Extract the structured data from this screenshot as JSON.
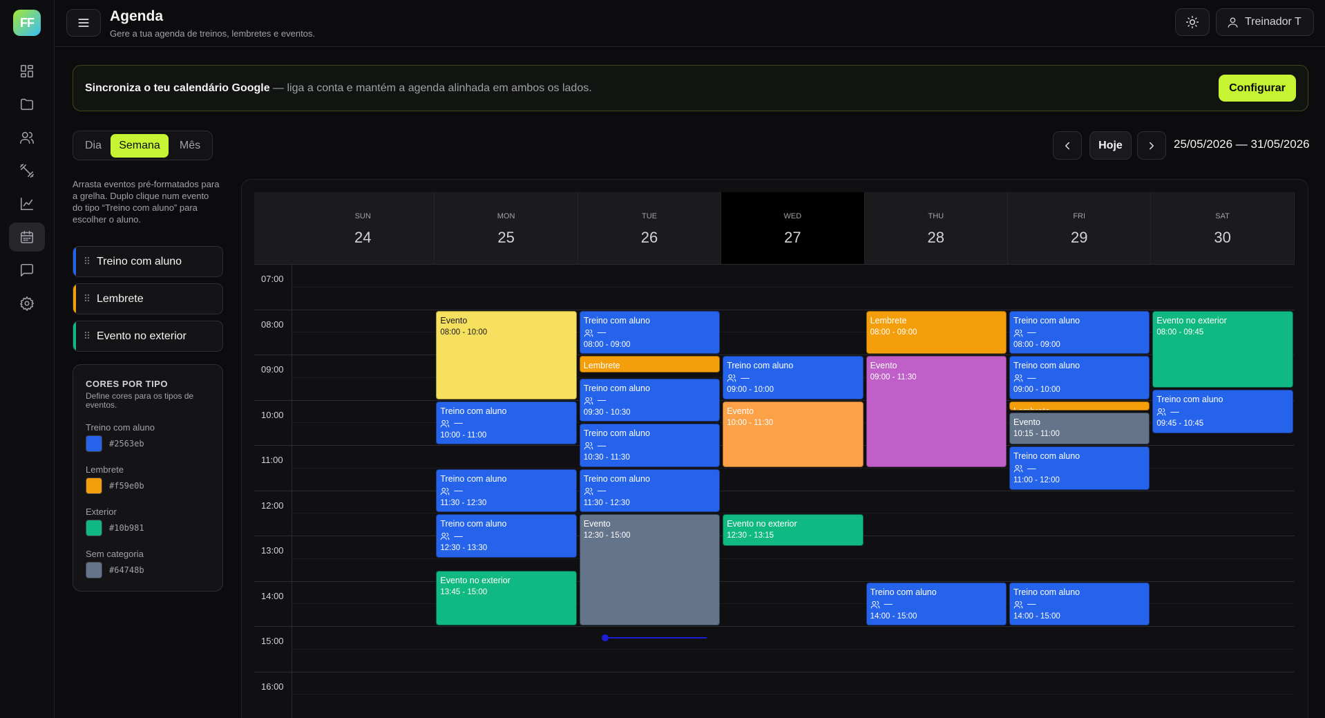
{
  "app": {
    "logo_text": "FF"
  },
  "header": {
    "title": "Agenda",
    "subtitle": "Gere a tua agenda de treinos, lembretes e eventos.",
    "user_label": "Treinador T"
  },
  "sidebar": {
    "items": [
      {
        "icon": "dashboard-icon"
      },
      {
        "icon": "folder-icon"
      },
      {
        "icon": "users-icon"
      },
      {
        "icon": "dumbbell-icon"
      },
      {
        "icon": "chart-icon"
      },
      {
        "icon": "calendar-icon",
        "active": true
      },
      {
        "icon": "message-icon"
      },
      {
        "icon": "gear-icon"
      }
    ]
  },
  "banner": {
    "strong": "Sincroniza o teu calendário Google",
    "text": " — liga a conta e mantém a agenda alinhada em ambos os lados.",
    "button": "Configurar"
  },
  "views": {
    "day": "Dia",
    "week": "Semana",
    "month": "Mês",
    "active": "week"
  },
  "nav": {
    "today": "Hoje",
    "range": "25/05/2026 — 31/05/2026"
  },
  "panel": {
    "hint": "Arrasta eventos pré-formatados para a grelha. Duplo clique num evento do tipo “Treino com aluno” para escolher o aluno.",
    "drag_items": [
      {
        "label": "Treino com aluno",
        "color": "#2563eb"
      },
      {
        "label": "Lembrete",
        "color": "#f59e0b"
      },
      {
        "label": "Evento no exterior",
        "color": "#10b981"
      }
    ],
    "colors": {
      "title": "CORES POR TIPO",
      "subtitle": "Define cores para os tipos de eventos.",
      "types": [
        {
          "label": "Treino com aluno",
          "hex": "#2563eb"
        },
        {
          "label": "Lembrete",
          "hex": "#f59e0b"
        },
        {
          "label": "Exterior",
          "hex": "#10b981"
        },
        {
          "label": "Sem categoria",
          "hex": "#64748b"
        }
      ]
    }
  },
  "calendar": {
    "days": [
      {
        "dow": "SUN",
        "num": "24"
      },
      {
        "dow": "MON",
        "num": "25"
      },
      {
        "dow": "TUE",
        "num": "26"
      },
      {
        "dow": "WED",
        "num": "27",
        "today": true
      },
      {
        "dow": "THU",
        "num": "28"
      },
      {
        "dow": "FRI",
        "num": "29"
      },
      {
        "dow": "SAT",
        "num": "30"
      }
    ],
    "hours": [
      "07:00",
      "08:00",
      "09:00",
      "10:00",
      "11:00",
      "12:00",
      "13:00",
      "14:00",
      "15:00",
      "16:00"
    ],
    "placeholder_student": "—",
    "events": [
      {
        "day": 1,
        "start": "08:00",
        "end": "10:00",
        "title": "Evento",
        "time": "08:00 - 10:00",
        "kind": "yellow"
      },
      {
        "day": 1,
        "start": "10:00",
        "end": "11:00",
        "title": "Treino com aluno",
        "time": "10:00 - 11:00",
        "kind": "blue",
        "student": true
      },
      {
        "day": 1,
        "start": "11:30",
        "end": "12:30",
        "title": "Treino com aluno",
        "time": "11:30 - 12:30",
        "kind": "blue",
        "student": true
      },
      {
        "day": 1,
        "start": "12:30",
        "end": "13:30",
        "title": "Treino com aluno",
        "time": "12:30 - 13:30",
        "kind": "blue",
        "student": true
      },
      {
        "day": 1,
        "start": "13:45",
        "end": "15:00",
        "title": "Evento no exterior",
        "time": "13:45 - 15:00",
        "kind": "green"
      },
      {
        "day": 2,
        "start": "08:00",
        "end": "09:00",
        "title": "Treino com aluno",
        "time": "08:00 - 09:00",
        "kind": "blue",
        "student": true
      },
      {
        "day": 2,
        "start": "09:00",
        "end": "09:25",
        "title": "Lembrete",
        "time": "",
        "kind": "amber"
      },
      {
        "day": 2,
        "start": "09:30",
        "end": "10:30",
        "title": "Treino com aluno",
        "time": "09:30 - 10:30",
        "kind": "blue",
        "student": true
      },
      {
        "day": 2,
        "start": "10:30",
        "end": "11:30",
        "title": "Treino com aluno",
        "time": "10:30 - 11:30",
        "kind": "blue",
        "student": true
      },
      {
        "day": 2,
        "start": "11:30",
        "end": "12:30",
        "title": "Treino com aluno",
        "time": "11:30 - 12:30",
        "kind": "blue",
        "student": true
      },
      {
        "day": 2,
        "start": "12:30",
        "end": "15:00",
        "title": "Evento",
        "time": "12:30 - 15:00",
        "kind": "slate"
      },
      {
        "day": 3,
        "start": "09:00",
        "end": "10:00",
        "title": "Treino com aluno",
        "time": "09:00 - 10:00",
        "kind": "blue",
        "student": true
      },
      {
        "day": 3,
        "start": "10:00",
        "end": "11:30",
        "title": "Evento",
        "time": "10:00 - 11:30",
        "kind": "orange"
      },
      {
        "day": 3,
        "start": "12:30",
        "end": "13:15",
        "title": "Evento no exterior",
        "time": "12:30 - 13:15",
        "kind": "green"
      },
      {
        "day": 4,
        "start": "08:00",
        "end": "09:00",
        "title": "Lembrete",
        "time": "08:00 - 09:00",
        "kind": "amber"
      },
      {
        "day": 4,
        "start": "09:00",
        "end": "11:30",
        "title": "Evento",
        "time": "09:00 - 11:30",
        "kind": "purple"
      },
      {
        "day": 4,
        "start": "14:00",
        "end": "15:00",
        "title": "Treino com aluno",
        "time": "14:00 - 15:00",
        "kind": "blue",
        "student": true
      },
      {
        "day": 5,
        "start": "08:00",
        "end": "09:00",
        "title": "Treino com aluno",
        "time": "08:00 - 09:00",
        "kind": "blue",
        "student": true
      },
      {
        "day": 5,
        "start": "09:00",
        "end": "10:00",
        "title": "Treino com aluno",
        "time": "09:00 - 10:00",
        "kind": "blue",
        "student": true
      },
      {
        "day": 5,
        "start": "10:00",
        "end": "10:15",
        "title": "Lembrete",
        "time": "",
        "kind": "amber"
      },
      {
        "day": 5,
        "start": "10:15",
        "end": "11:00",
        "title": "Evento",
        "time": "10:15 - 11:00",
        "kind": "slate"
      },
      {
        "day": 5,
        "start": "11:00",
        "end": "12:00",
        "title": "Treino com aluno",
        "time": "11:00 - 12:00",
        "kind": "blue",
        "student": true
      },
      {
        "day": 5,
        "start": "14:00",
        "end": "15:00",
        "title": "Treino com aluno",
        "time": "14:00 - 15:00",
        "kind": "blue",
        "student": true
      },
      {
        "day": 6,
        "start": "08:00",
        "end": "09:45",
        "title": "Evento no exterior",
        "time": "08:00 - 09:45",
        "kind": "green"
      },
      {
        "day": 6,
        "start": "09:45",
        "end": "10:45",
        "title": "Treino com aluno",
        "time": "09:45 - 10:45",
        "kind": "blue",
        "student": true
      }
    ]
  }
}
